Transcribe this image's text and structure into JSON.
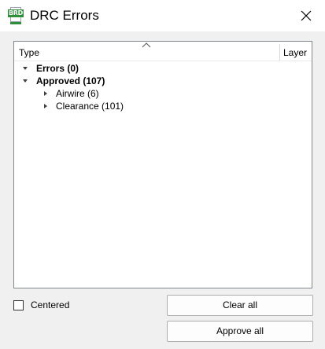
{
  "window": {
    "title": "DRC Errors",
    "app_icon": {
      "name": "eagle-brd-icon",
      "badge_text": "BRD",
      "color": "#2f8f3a"
    }
  },
  "tree": {
    "columns": [
      "Type",
      "Layer"
    ],
    "sort_column": "Type",
    "sort_direction": "ascending",
    "rows": [
      {
        "label": "Errors (0)",
        "expanded": true,
        "bold": true
      },
      {
        "label": "Approved (107)",
        "expanded": true,
        "bold": true
      },
      {
        "label": "Airwire (6)",
        "expanded": false,
        "bold": false
      },
      {
        "label": "Clearance (101)",
        "expanded": false,
        "bold": false
      }
    ]
  },
  "options": {
    "centered_label": "Centered",
    "centered_checked": false
  },
  "buttons": {
    "clear_all": "Clear all",
    "approve_all": "Approve all"
  }
}
